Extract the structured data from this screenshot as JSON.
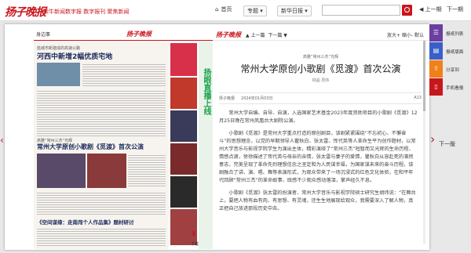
{
  "header": {
    "logo": "扬子晚报",
    "slogan": "紫牛新闻数字报 数字报刊 聚焦新闻",
    "home": "首页",
    "topic": "专题",
    "history": "新华日报",
    "search_placeholder": "",
    "prev_page": "上一期",
    "next_page": "下一期"
  },
  "paper": {
    "page_name": "身边事",
    "logo": "扬子晚报",
    "h1_sub": "盐城市新建成的高速公路",
    "h1": "河西中新增2幅优质宅地",
    "h2_sub": "高雅“常州三杰”光辉",
    "h2": "常州大学原创小歌剧《觅渡》首次公演",
    "h3": "《空间谋缘：走南闯个人作品集》题材研讨",
    "ad_vertical": "扬眼直播上线",
    "pdf_label": "PDF",
    "download": "下载"
  },
  "article": {
    "logo": "扬子晚报",
    "nav_prev": "上一篇",
    "nav_next": "下一篇",
    "zoom_in": "放大+",
    "zoom_out": "缩小-",
    "reset": "默认",
    "kicker": "高雅“常州三杰”光辉",
    "title": "常州大学原创小歌剧《觅渡》首次公演",
    "byline": "柳晶 周炜",
    "source": "扬子晚报",
    "date": "2024年01月03日",
    "page_no": "A13",
    "paragraphs": [
      "常州大学自编、自导、自演，入选国家艺术基金2023年度资助项目的小歌剧《觅渡》12月25日晚在常州凤凰台大剧院公演。",
      "小歌剧《觅渡》是常州大学重点打造的原创剧目，该剧紧紧围绕“不忘初心、不懈奋斗”的思想理念，以党的早期领导人瞿秋白、张太雷、恽代英等人革命生平为创作题材，以常州大学音乐与影视学院学生为演出主体，精彩演绎了“常州三杰”短暂而又光辉的生命历程、情感点滴，徐徐描述了恽代英与母亲的亲情，张太雷与妻子的爱情，瞿秋白从容赴死的凛然意志，完美呈现了革命先烈理想信念之坚定和为人民谋幸福，为国家谋未来的奋斗历程。该剧融合了讲、演、唱、舞等表演形式，为观众带来了一场沉浸式的红色文化体验，在和平年代回顾“常州三杰”的革命故事，既感不少观众感动落泪，掌声经久不息。",
      "小歌剧《觅渡》张太雷的扮演者、常州大学音乐与影视学院硕士研究生胡炜说：“在舞台上，要把人物有血有肉、有思想、有灵魂，还生生地展现给观众，我需要深入了解人物，真正把自己放进那段历史中去。"
    ]
  },
  "side": {
    "item1": "报纸列表",
    "item2": "报纸版面",
    "item3": "分享到",
    "item4": "手机看报",
    "next_label": "下一版"
  },
  "colors": {
    "brand_red": "#c8161d",
    "headline_blue": "#1a2a5c",
    "ad_green": "#18a34a",
    "side_purple": "#6b3fa0",
    "side_blue": "#3a5fc8",
    "side_orange": "#f0801a"
  }
}
